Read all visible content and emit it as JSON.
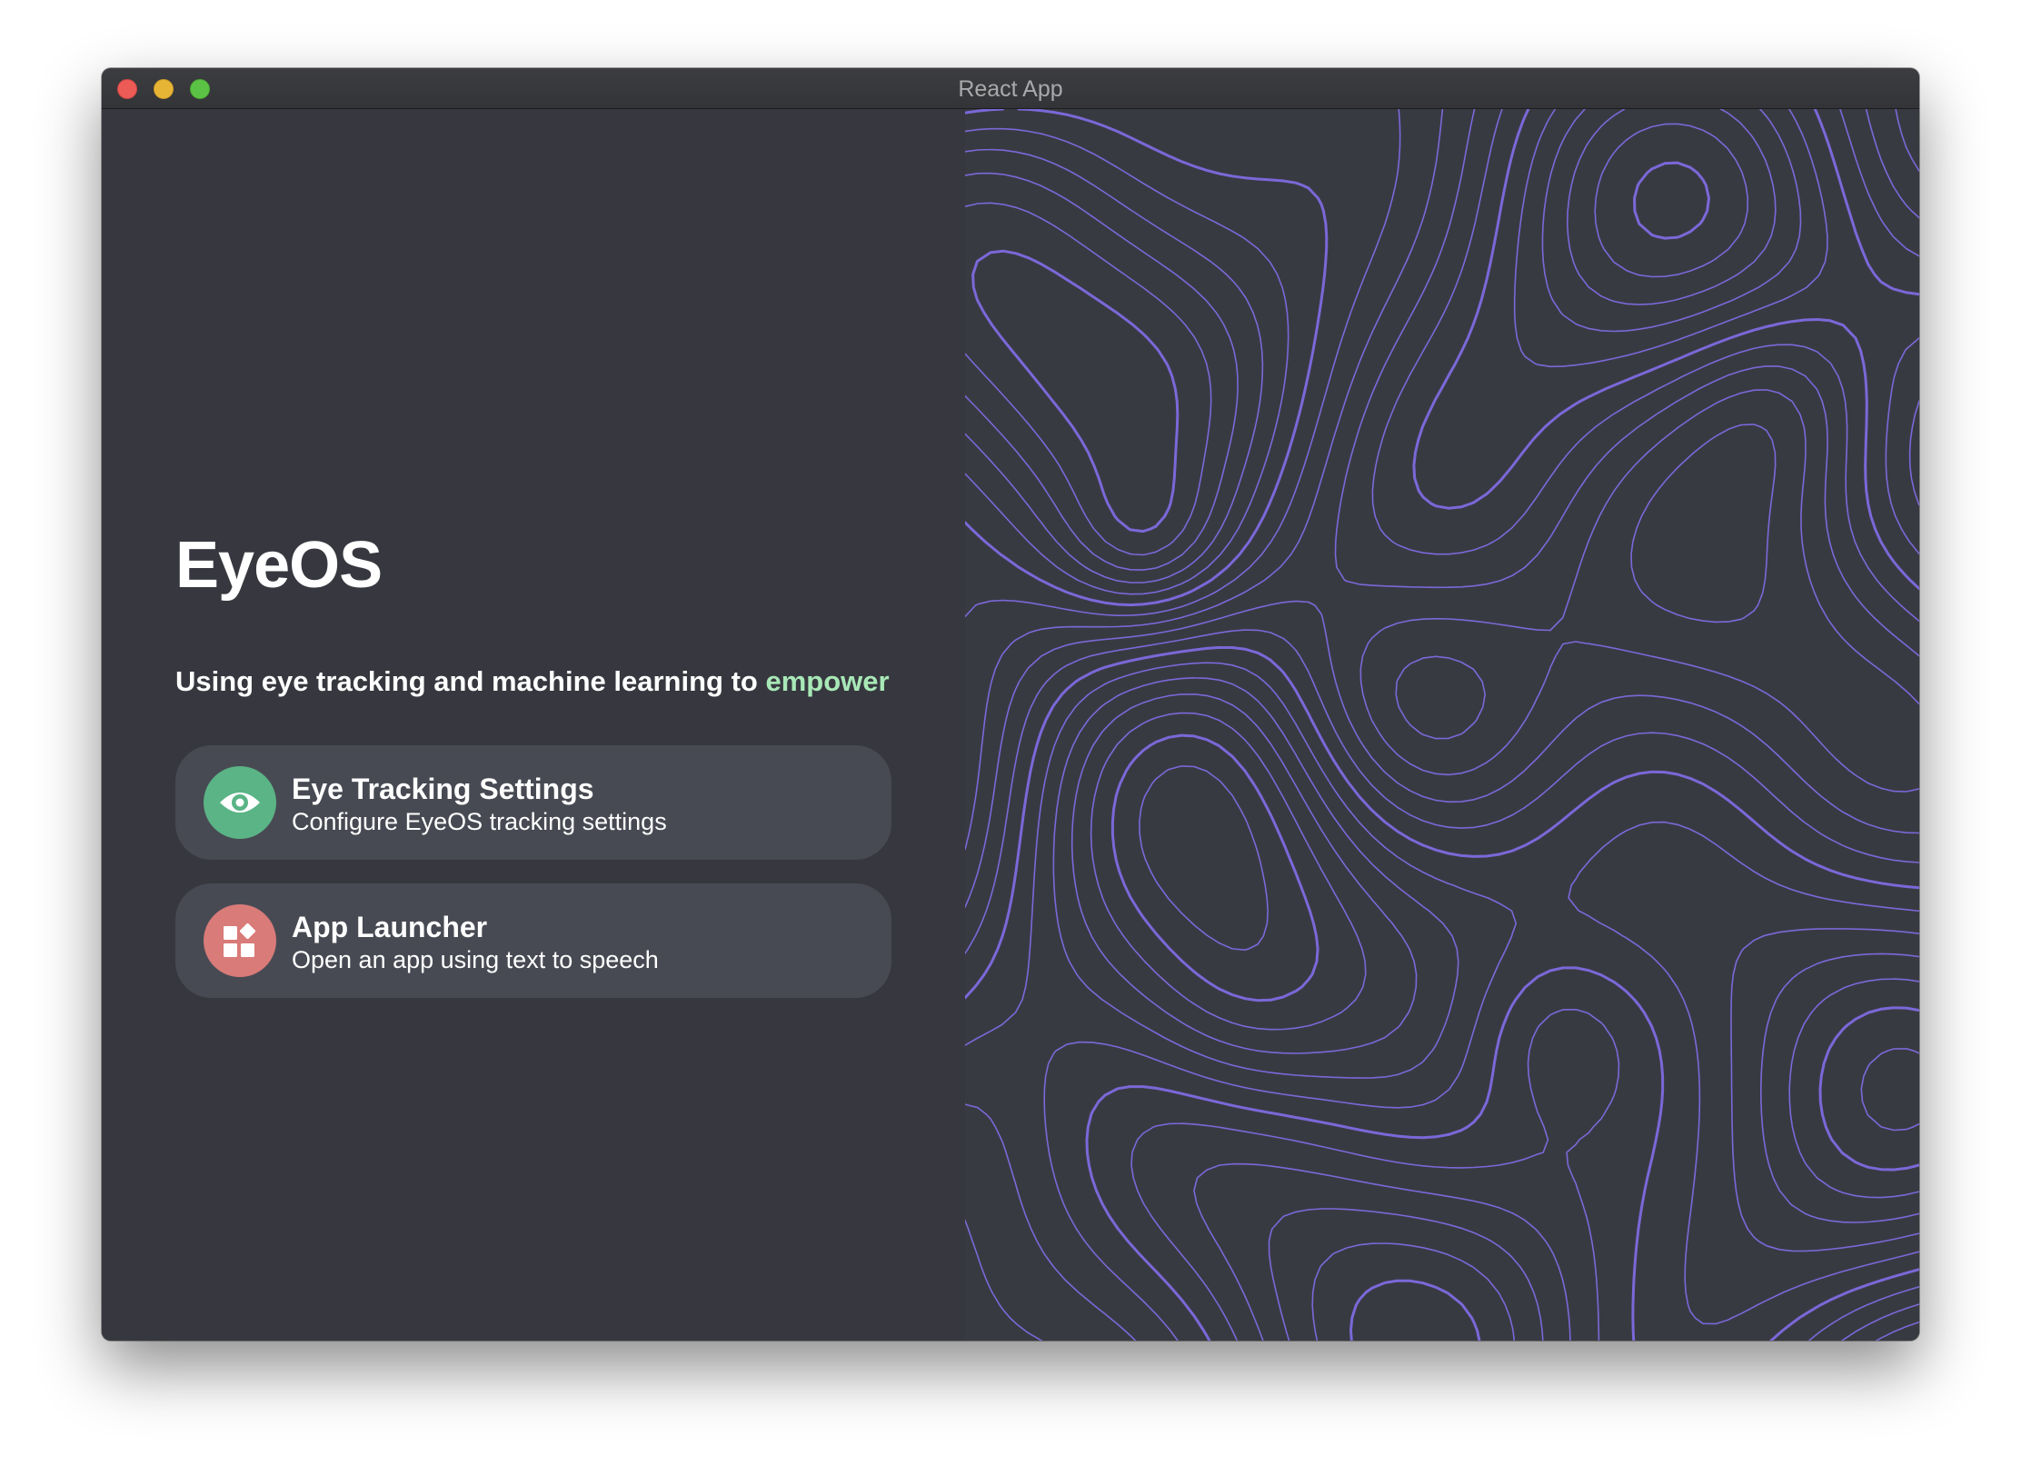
{
  "window": {
    "title": "React App"
  },
  "hero": {
    "title": "EyeOS",
    "subtitle_prefix": "Using eye tracking and machine learning to ",
    "subtitle_highlight": "empower"
  },
  "cards": [
    {
      "title": "Eye Tracking Settings",
      "description": "Configure EyeOS tracking settings",
      "icon": "eye-icon",
      "color": "#5ab486"
    },
    {
      "title": "App Launcher",
      "description": "Open an app using text to speech",
      "icon": "app-grid-icon",
      "color": "#d97b79"
    }
  ],
  "colors": {
    "background": "#37383f",
    "card": "#484a53",
    "accent": "#a8e8b7",
    "topo_lines": "#7b68d8"
  }
}
